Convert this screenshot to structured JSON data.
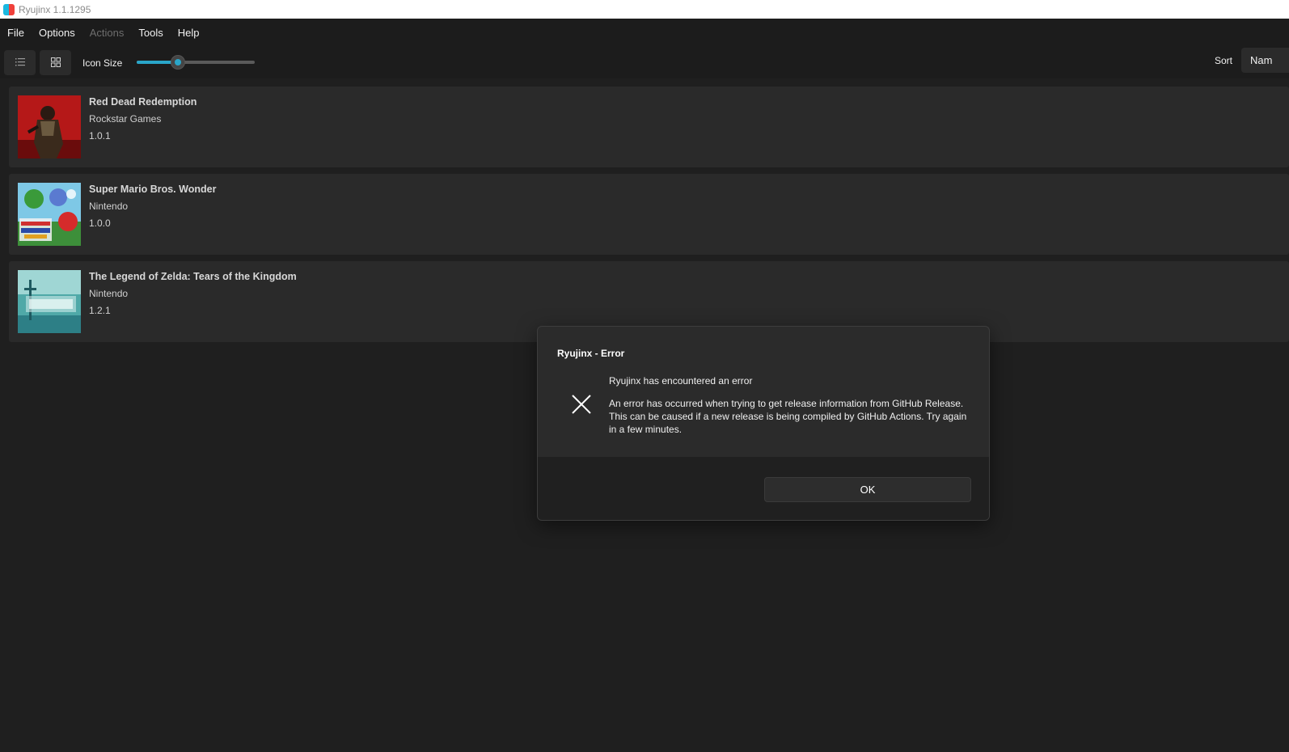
{
  "window": {
    "title": "Ryujinx 1.1.1295"
  },
  "menu": [
    {
      "label": "File",
      "enabled": true
    },
    {
      "label": "Options",
      "enabled": true
    },
    {
      "label": "Actions",
      "enabled": false
    },
    {
      "label": "Tools",
      "enabled": true
    },
    {
      "label": "Help",
      "enabled": true
    }
  ],
  "toolbar": {
    "icon_size_label": "Icon Size",
    "icon_size_value": 0.35,
    "sort_label": "Sort",
    "sort_value": "Nam"
  },
  "games": [
    {
      "title": "Red Dead Redemption",
      "developer": "Rockstar Games",
      "version": "1.0.1"
    },
    {
      "title": "Super Mario Bros. Wonder",
      "developer": "Nintendo",
      "version": "1.0.0"
    },
    {
      "title": "The Legend of Zelda: Tears of the Kingdom",
      "developer": "Nintendo",
      "version": "1.2.1"
    }
  ],
  "dialog": {
    "title": "Ryujinx - Error",
    "heading": "Ryujinx has encountered an error",
    "message": "An error has occurred when trying to get release information from GitHub Release. This can be caused if a new release is being compiled by GitHub Actions. Try again in a few minutes.",
    "ok_label": "OK",
    "icon": "close-icon"
  },
  "colors": {
    "accent": "#2aa6c9",
    "background": "#1f1f1f",
    "row": "#2a2a2a",
    "dialog": "#2b2b2b"
  }
}
